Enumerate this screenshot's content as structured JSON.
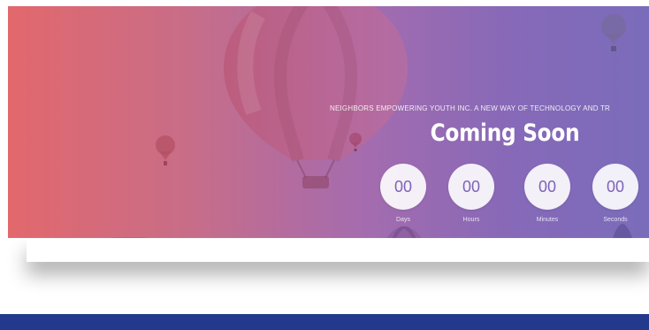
{
  "hero": {
    "tagline": "NEIGHBORS EMPOWERING YOUTH INC. A NEW WAY OF TECHNOLOGY AND TR",
    "headline": "Coming Soon",
    "countdown": [
      {
        "value": "00",
        "label": "Days"
      },
      {
        "value": "00",
        "label": "Hours"
      },
      {
        "value": "00",
        "label": "Minutes"
      },
      {
        "value": "00",
        "label": "Seconds"
      }
    ]
  },
  "colors": {
    "gradient_start": "#e2686c",
    "gradient_end": "#7a6cbb",
    "footer": "#233a8c",
    "countdown_text": "#7d63b8"
  },
  "icons": {
    "background": "hot-air-balloon-icon"
  }
}
